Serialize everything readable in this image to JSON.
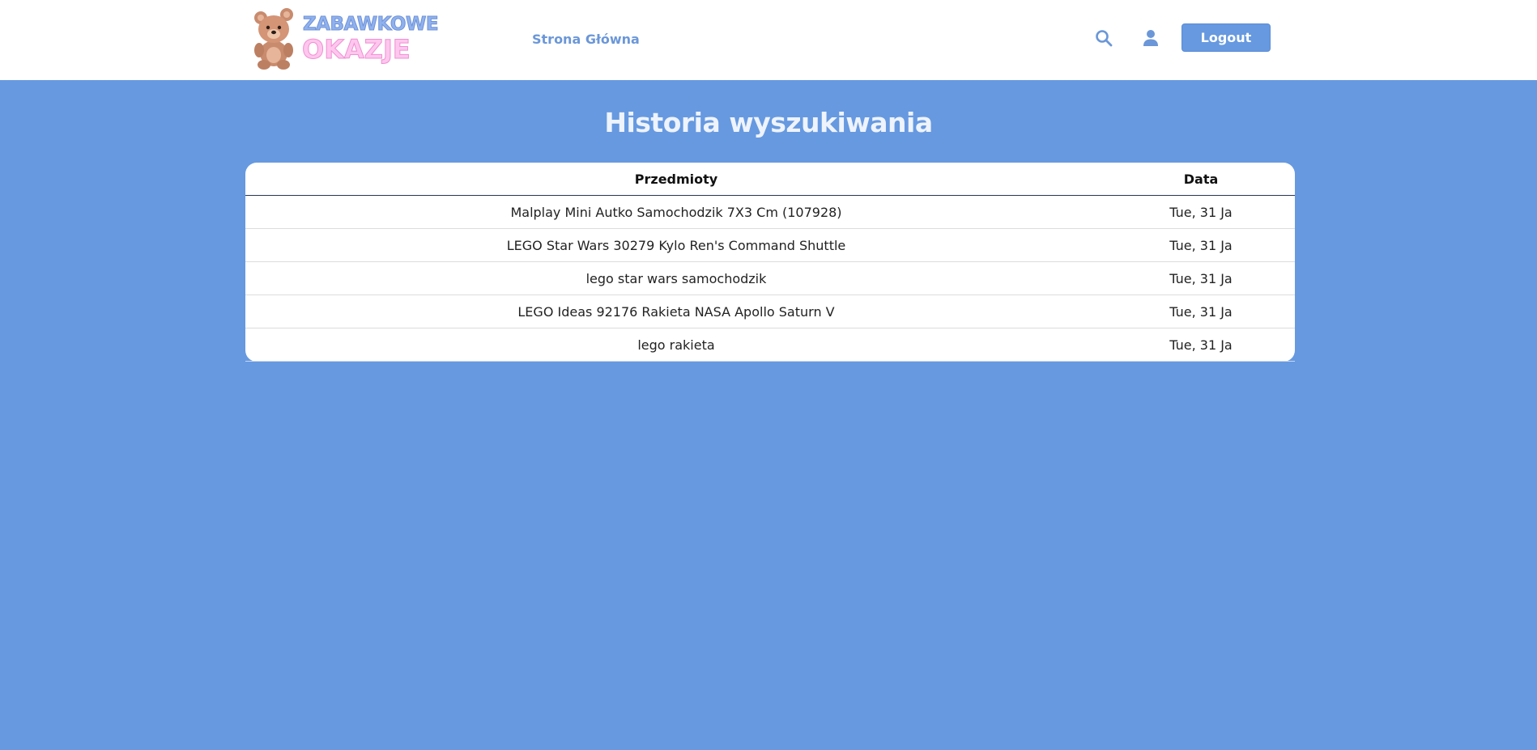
{
  "header": {
    "logo": {
      "line1": "ZABAWKOWE",
      "line2": "OKAZJE",
      "icon": "teddy-bear-logo"
    },
    "nav_link": "Strona Główna",
    "search_icon": "search-icon",
    "user_icon": "user-icon",
    "logout_label": "Logout"
  },
  "main": {
    "title": "Historia wyszukiwania",
    "table": {
      "columns": [
        "Przedmioty",
        "Data"
      ],
      "rows": [
        {
          "item": "Malplay Mini Autko Samochodzik 7X3 Cm (107928)",
          "date": "Tue, 31 Ja"
        },
        {
          "item": "LEGO Star Wars 30279 Kylo Ren's Command Shuttle",
          "date": "Tue, 31 Ja"
        },
        {
          "item": "lego star wars samochodzik",
          "date": "Tue, 31 Ja"
        },
        {
          "item": "LEGO Ideas 92176 Rakieta NASA Apollo Saturn V",
          "date": "Tue, 31 Ja"
        },
        {
          "item": "lego rakieta",
          "date": "Tue, 31 Ja"
        }
      ]
    }
  },
  "colors": {
    "background": "#6699e0",
    "navbar": "#ffffff",
    "accent": "#6699e0",
    "nav_link": "#6b97d8",
    "logo_blue": "#8fb1ee",
    "logo_pink": "#ffc6ee"
  }
}
